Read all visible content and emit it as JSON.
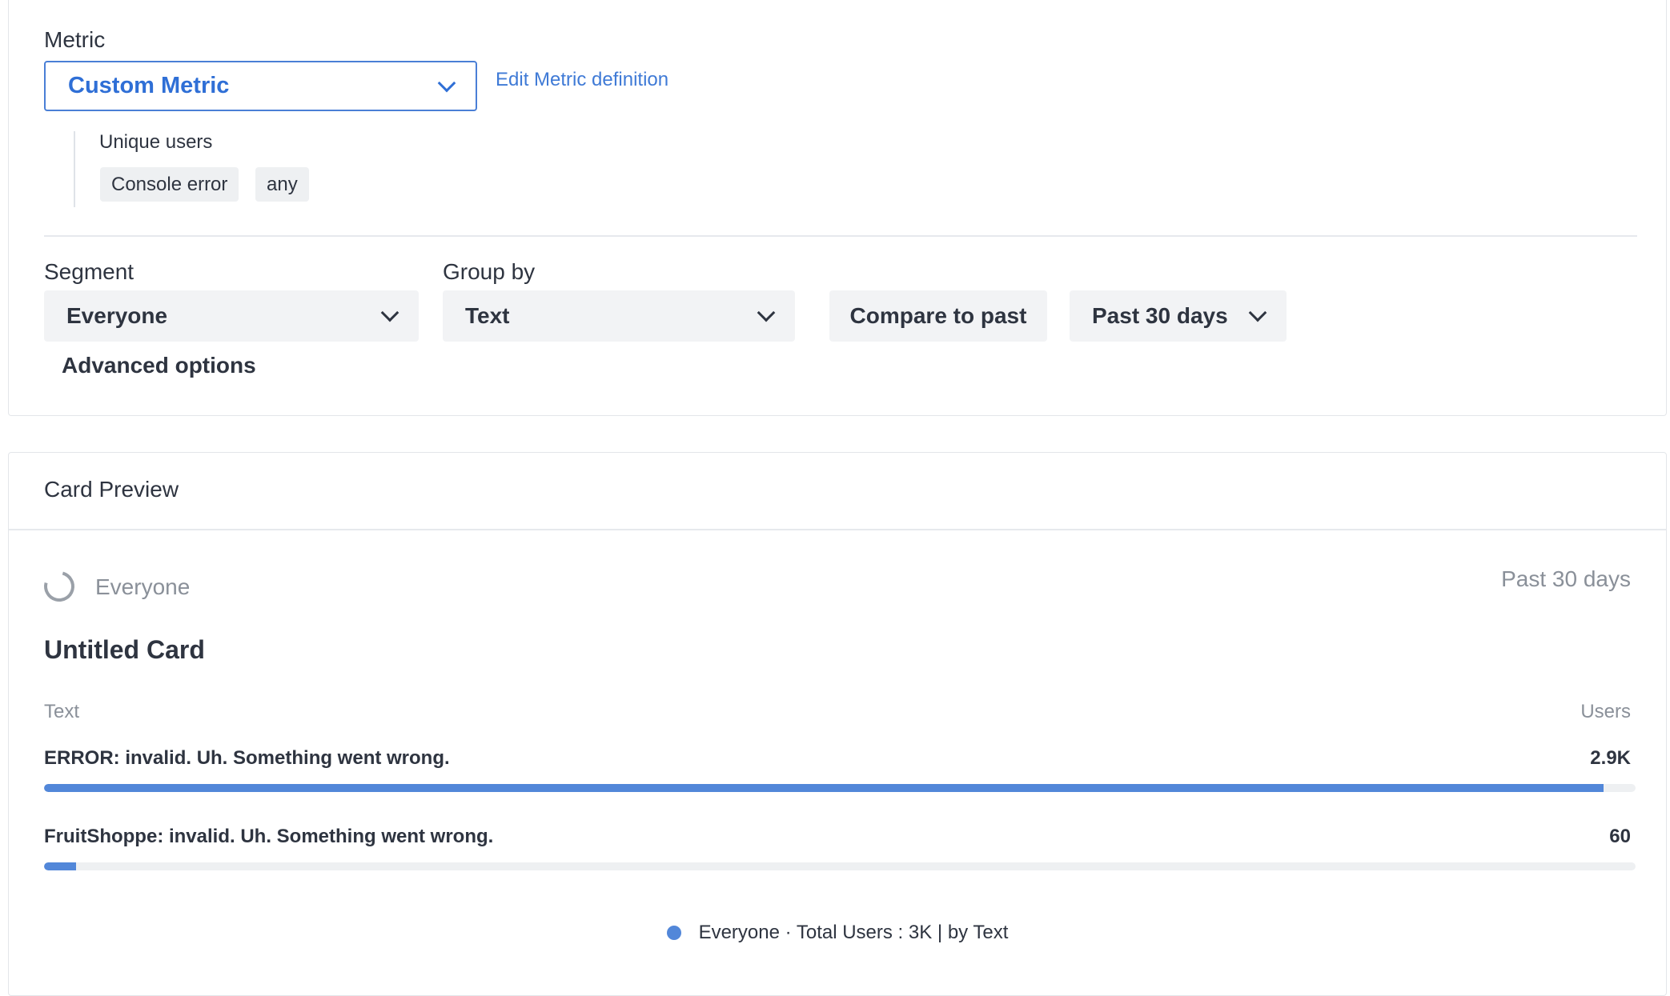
{
  "metric": {
    "label": "Metric",
    "selected": "Custom Metric",
    "edit_link": "Edit Metric definition",
    "definition": {
      "title": "Unique users",
      "chips": [
        "Console error",
        "any"
      ]
    }
  },
  "segment": {
    "label": "Segment",
    "selected": "Everyone"
  },
  "group_by": {
    "label": "Group by",
    "selected": "Text"
  },
  "compare_button": "Compare to past",
  "date_range": "Past 30 days",
  "advanced_options": "Advanced options",
  "preview": {
    "heading": "Card Preview",
    "segment_name": "Everyone",
    "range": "Past 30 days",
    "card_title": "Untitled Card",
    "col_left": "Text",
    "col_right": "Users",
    "rows": [
      {
        "label": "ERROR: invalid. Uh. Something went wrong.",
        "value": "2.9K",
        "fraction": 0.98
      },
      {
        "label": "FruitShoppe: invalid. Uh. Something went wrong.",
        "value": "60",
        "fraction": 0.02
      }
    ],
    "legend": "Everyone · Total Users : 3K | by Text",
    "accent_color": "#5287d9"
  }
}
